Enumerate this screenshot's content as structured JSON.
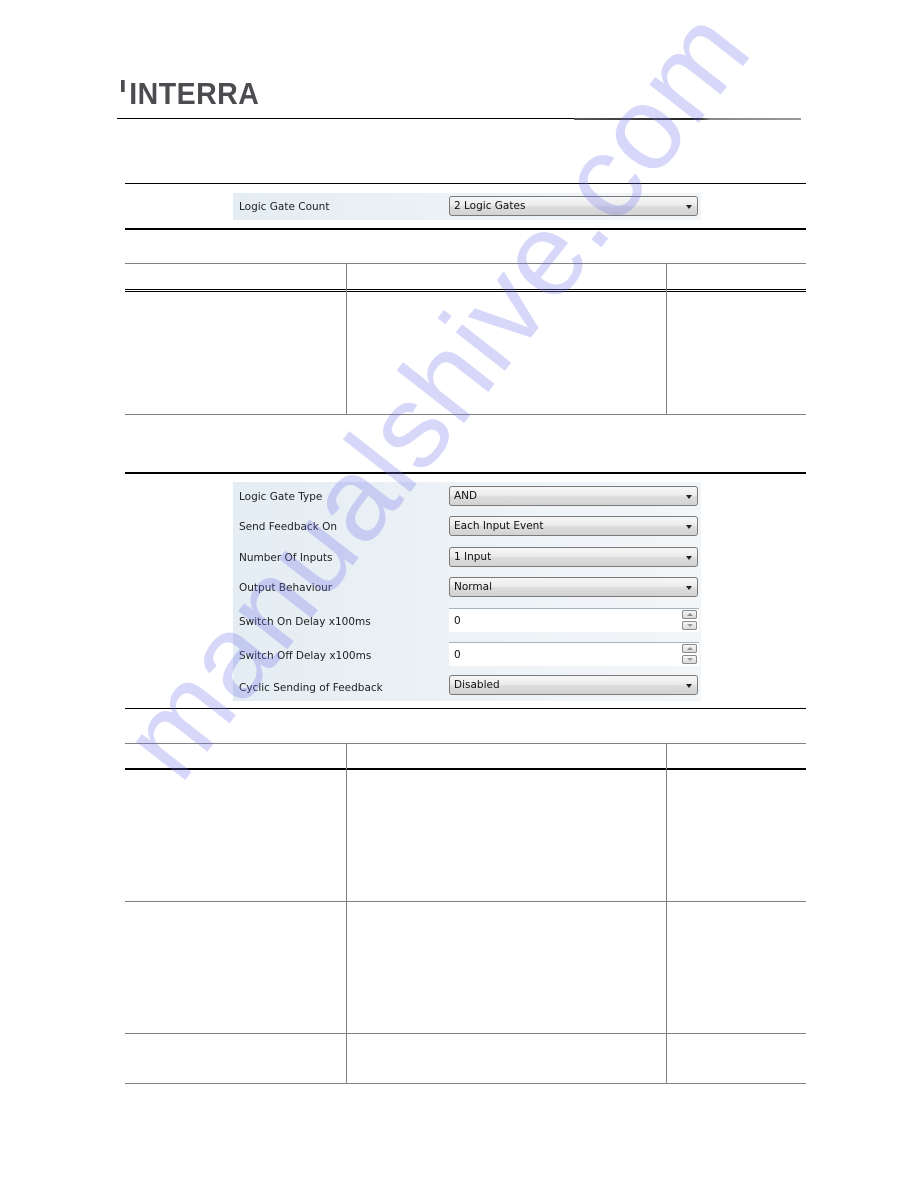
{
  "header": {
    "logo_text": "INTERRA"
  },
  "panel1": {
    "rows": [
      {
        "label": "Logic Gate Count",
        "type": "select",
        "value": "2 Logic Gates"
      }
    ]
  },
  "table1": {
    "columns": [
      "",
      "",
      ""
    ],
    "rows": [
      [
        "",
        "",
        ""
      ]
    ]
  },
  "panel2": {
    "rows": [
      {
        "label": "Logic Gate Type",
        "type": "select",
        "value": "AND"
      },
      {
        "label": "Send Feedback On",
        "type": "select",
        "value": "Each Input Event"
      },
      {
        "label": "Number Of Inputs",
        "type": "select",
        "value": "1 Input"
      },
      {
        "label": "Output Behaviour",
        "type": "select",
        "value": "Normal"
      },
      {
        "label": "Switch On Delay x100ms",
        "type": "spin",
        "value": "0"
      },
      {
        "label": "Switch Off Delay x100ms",
        "type": "spin",
        "value": "0"
      },
      {
        "label": "Cyclic Sending of Feedback",
        "type": "select",
        "value": "Disabled"
      }
    ]
  },
  "table2": {
    "columns": [
      "",
      "",
      ""
    ],
    "rows": [
      [
        "",
        "",
        ""
      ],
      [
        "",
        "",
        ""
      ],
      [
        "",
        "",
        ""
      ]
    ]
  },
  "watermark": {
    "text": "manualshive.com",
    "color": "#6e6eeb"
  }
}
